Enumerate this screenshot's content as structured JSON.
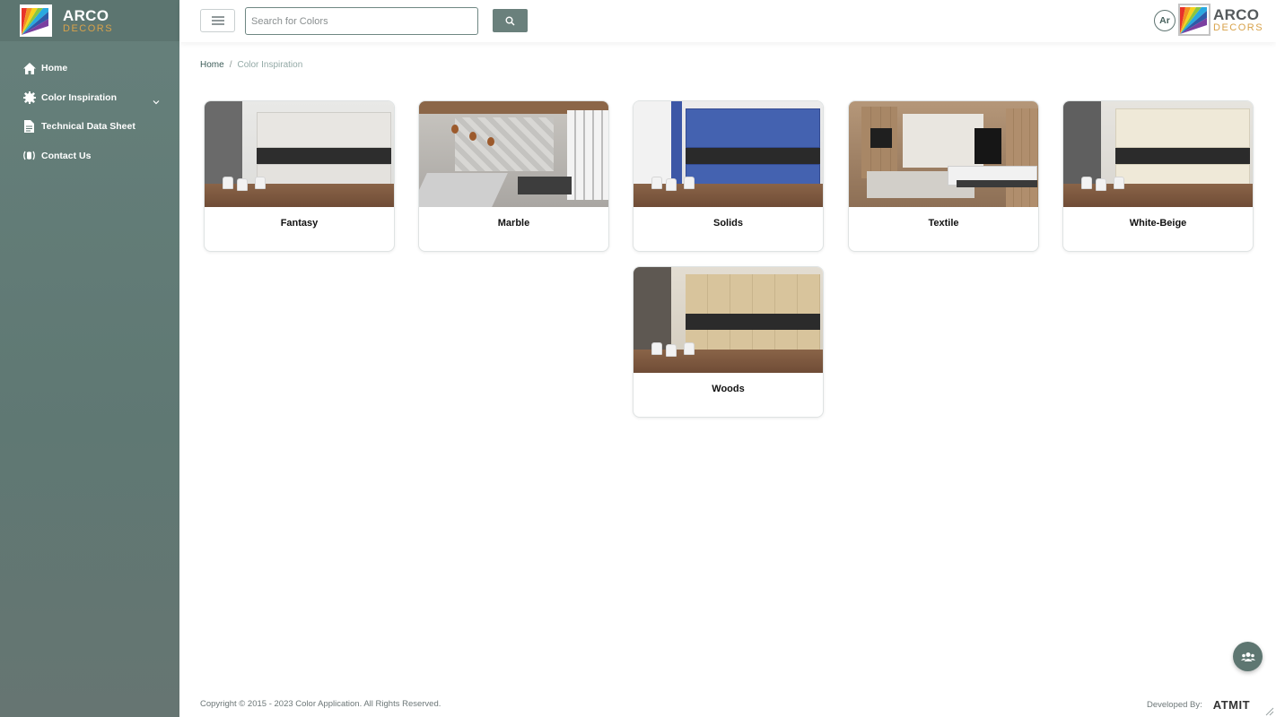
{
  "brand": {
    "name": "ARCO",
    "sub": "DECORS"
  },
  "sidebar": {
    "items": [
      {
        "label": "Home",
        "icon": "home-icon"
      },
      {
        "label": "Color Inspiration",
        "icon": "gear-icon"
      },
      {
        "label": "Technical Data Sheet",
        "icon": "document-icon"
      },
      {
        "label": "Contact Us",
        "icon": "phone-icon"
      }
    ]
  },
  "header": {
    "search_placeholder": "Search for Colors",
    "lang_badge": "Ar"
  },
  "breadcrumb": {
    "home": "Home",
    "separator": "/",
    "current": "Color Inspiration"
  },
  "cards": [
    {
      "title": "Fantasy"
    },
    {
      "title": "Marble"
    },
    {
      "title": "Solids"
    },
    {
      "title": "Textile"
    },
    {
      "title": "White-Beige"
    },
    {
      "title": "Woods"
    }
  ],
  "footer": {
    "copyright": "Copyright © 2015 - 2023 Color Application. All Rights Reserved.",
    "developed_by": "Developed By:",
    "developer": "ATMIT"
  },
  "colors": {
    "sidebar": "#627b76",
    "accent": "#6a807c",
    "brand_gold": "#d8a24a"
  }
}
